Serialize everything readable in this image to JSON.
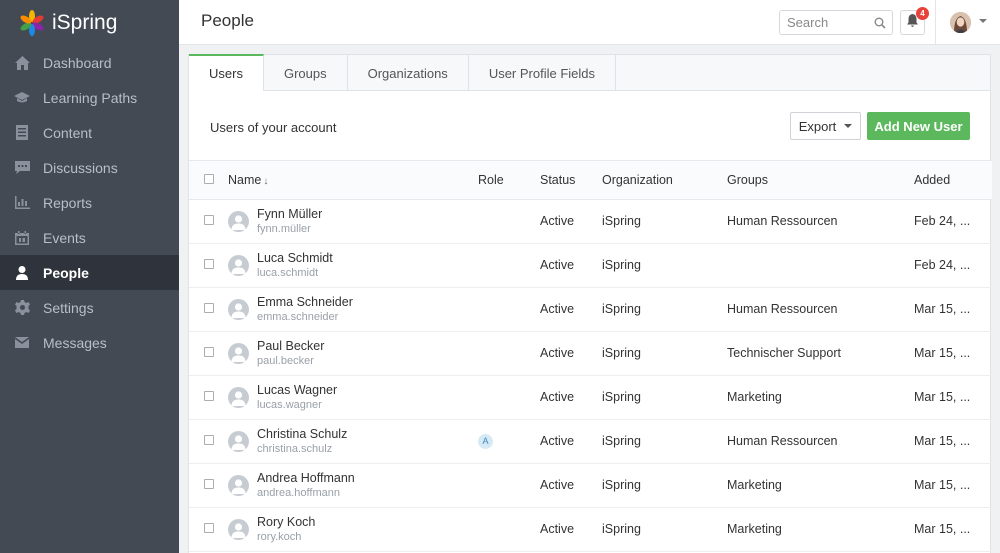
{
  "app": {
    "name": "iSpring"
  },
  "sidebar": {
    "items": [
      {
        "label": "Dashboard",
        "icon": "home-icon",
        "active": false
      },
      {
        "label": "Learning Paths",
        "icon": "graduation-cap-icon",
        "active": false
      },
      {
        "label": "Content",
        "icon": "document-icon",
        "active": false
      },
      {
        "label": "Discussions",
        "icon": "chat-icon",
        "active": false
      },
      {
        "label": "Reports",
        "icon": "bar-chart-icon",
        "active": false
      },
      {
        "label": "Events",
        "icon": "calendar-icon",
        "active": false
      },
      {
        "label": "People",
        "icon": "user-icon",
        "active": true
      },
      {
        "label": "Settings",
        "icon": "gear-icon",
        "active": false
      },
      {
        "label": "Messages",
        "icon": "envelope-icon",
        "active": false
      }
    ]
  },
  "header": {
    "title": "People",
    "search_placeholder": "Search",
    "notifications_count": "4"
  },
  "tabs": [
    {
      "label": "Users",
      "active": true
    },
    {
      "label": "Groups",
      "active": false
    },
    {
      "label": "Organizations",
      "active": false
    },
    {
      "label": "User Profile Fields",
      "active": false
    }
  ],
  "toolbar": {
    "title": "Users of your account",
    "export_label": "Export",
    "add_label": "Add New User"
  },
  "table": {
    "columns": {
      "name": "Name",
      "role": "Role",
      "status": "Status",
      "organization": "Organization",
      "groups": "Groups",
      "added": "Added"
    },
    "rows": [
      {
        "name": "Fynn Müller",
        "login": "fynn.müller",
        "role": "",
        "status": "Active",
        "organization": "iSpring",
        "groups": "Human Ressourcen",
        "added": "Feb 24, ..."
      },
      {
        "name": "Luca Schmidt",
        "login": "luca.schmidt",
        "role": "",
        "status": "Active",
        "organization": "iSpring",
        "groups": "",
        "added": "Feb 24, ..."
      },
      {
        "name": "Emma Schneider",
        "login": "emma.schneider",
        "role": "",
        "status": "Active",
        "organization": "iSpring",
        "groups": "Human Ressourcen",
        "added": "Mar 15, ..."
      },
      {
        "name": "Paul Becker",
        "login": "paul.becker",
        "role": "",
        "status": "Active",
        "organization": "iSpring",
        "groups": "Technischer Support",
        "added": "Mar 15, ..."
      },
      {
        "name": "Lucas Wagner",
        "login": "lucas.wagner",
        "role": "",
        "status": "Active",
        "organization": "iSpring",
        "groups": "Marketing",
        "added": "Mar 15, ..."
      },
      {
        "name": "Christina Schulz",
        "login": "christina.schulz",
        "role": "A",
        "status": "Active",
        "organization": "iSpring",
        "groups": "Human Ressourcen",
        "added": "Mar 15, ..."
      },
      {
        "name": "Andrea Hoffmann",
        "login": "andrea.hoffmann",
        "role": "",
        "status": "Active",
        "organization": "iSpring",
        "groups": "Marketing",
        "added": "Mar 15, ..."
      },
      {
        "name": "Rory Koch",
        "login": "rory.koch",
        "role": "",
        "status": "Active",
        "organization": "iSpring",
        "groups": "Marketing",
        "added": "Mar 15, ..."
      }
    ]
  },
  "colors": {
    "accent": "#5cb85c",
    "sidebar_bg": "#434a54",
    "sidebar_active": "#2f343c",
    "badge": "#e8433b"
  }
}
